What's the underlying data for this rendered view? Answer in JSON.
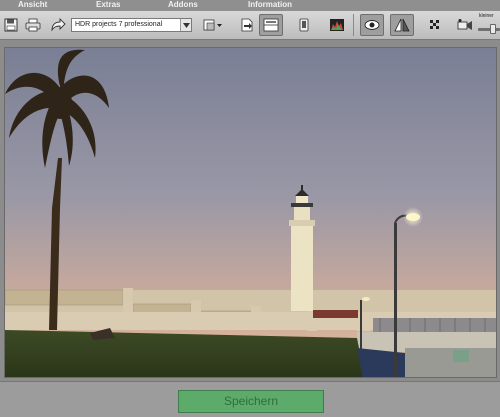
{
  "menu": {
    "items": [
      "Ansicht",
      "Extras",
      "Addons",
      "Information"
    ]
  },
  "toolbar": {
    "project_select_value": "HDR projects 7 professional",
    "zoom_label": "kleiner"
  },
  "footer": {
    "save_label": "Speichern"
  },
  "colors": {
    "save_button": "#5cab6a",
    "toolbar": "#cfcfcf",
    "background": "#8c8c8c"
  }
}
